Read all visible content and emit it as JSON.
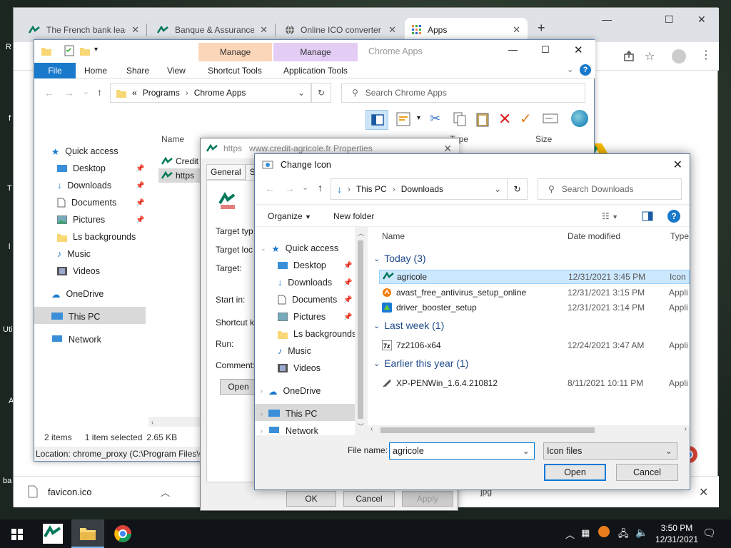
{
  "desktop": {
    "left_labels": [
      "R",
      "f",
      "T",
      "l",
      "Uti",
      "A",
      "ba"
    ]
  },
  "chrome": {
    "tabs": [
      {
        "label": "The French bank lead"
      },
      {
        "label": "Banque & Assurance"
      },
      {
        "label": "Online ICO converter"
      },
      {
        "label": "Apps"
      }
    ],
    "download_item": "favicon.ico",
    "status_partial": "jpg"
  },
  "explorer": {
    "title": "Chrome Apps",
    "ctx_manage_1": "Manage",
    "ctx_manage_2": "Manage",
    "ribbon_tabs": [
      "File",
      "Home",
      "Share",
      "View",
      "Shortcut Tools",
      "Application Tools"
    ],
    "breadcrumb_prefix": "«",
    "breadcrumb": [
      "Programs",
      "Chrome Apps"
    ],
    "search_placeholder": "Search Chrome Apps",
    "columns": {
      "name": "Name",
      "type": "Type",
      "size": "Size"
    },
    "files": [
      "Credit",
      "https"
    ],
    "nav": [
      {
        "label": "Quick access"
      },
      {
        "label": "Desktop",
        "pin": true
      },
      {
        "label": "Downloads",
        "pin": true
      },
      {
        "label": "Documents",
        "pin": true
      },
      {
        "label": "Pictures",
        "pin": true
      },
      {
        "label": "Ls backgrounds"
      },
      {
        "label": "Music"
      },
      {
        "label": "Videos"
      },
      {
        "label": "OneDrive"
      },
      {
        "label": "This PC"
      },
      {
        "label": "Network"
      }
    ],
    "status": {
      "items": "2 items",
      "selected": "1 item selected",
      "size": "2.65 KB"
    },
    "location": "Location: chrome_proxy (C:\\Program Files\\C"
  },
  "properties": {
    "title": "https   www.credit-agricole.fr Properties",
    "tabs": [
      "General",
      "Sh"
    ],
    "labels": [
      "Target typ",
      "Target loc",
      "Target:",
      "Start in:",
      "Shortcut k",
      "Run:",
      "Comment:"
    ],
    "open_btn": "Open",
    "ok": "OK",
    "cancel": "Cancel",
    "apply": "Apply"
  },
  "change_icon": {
    "title": "Change Icon",
    "address": [
      "This PC",
      "Downloads"
    ],
    "search_placeholder": "Search Downloads",
    "organize": "Organize",
    "new_folder": "New folder",
    "nav": [
      {
        "label": "Quick access"
      },
      {
        "label": "Desktop",
        "pin": true
      },
      {
        "label": "Downloads",
        "pin": true
      },
      {
        "label": "Documents",
        "pin": true
      },
      {
        "label": "Pictures",
        "pin": true
      },
      {
        "label": "Ls backgrounds"
      },
      {
        "label": "Music"
      },
      {
        "label": "Videos"
      },
      {
        "label": "OneDrive"
      },
      {
        "label": "This PC"
      },
      {
        "label": "Network"
      }
    ],
    "columns": {
      "name": "Name",
      "date": "Date modified",
      "type": "Type"
    },
    "groups": [
      {
        "label": "Today (3)",
        "files": [
          {
            "name": "agricole",
            "date": "12/31/2021 3:45 PM",
            "type": "Icon",
            "selected": true
          },
          {
            "name": "avast_free_antivirus_setup_online",
            "date": "12/31/2021 3:15 PM",
            "type": "Appli"
          },
          {
            "name": "driver_booster_setup",
            "date": "12/31/2021 3:14 PM",
            "type": "Appli"
          }
        ]
      },
      {
        "label": "Last week (1)",
        "files": [
          {
            "name": "7z2106-x64",
            "date": "12/24/2021 3:47 AM",
            "type": "Appli"
          }
        ]
      },
      {
        "label": "Earlier this year (1)",
        "files": [
          {
            "name": "XP-PENWin_1.6.4.210812",
            "date": "8/11/2021 10:11 PM",
            "type": "Appli"
          }
        ]
      }
    ],
    "file_name_label": "File name:",
    "file_name_value": "agricole",
    "file_type": "Icon files",
    "open": "Open",
    "cancel": "Cancel"
  },
  "taskbar": {
    "time": "3:50 PM",
    "date": "12/31/2021"
  },
  "colors": {
    "accent": "#0078d7",
    "file_tab": "#1979ca",
    "manage1": "#fcd6b8",
    "manage2": "#e3cdf5",
    "ca_green": "#00785a"
  }
}
